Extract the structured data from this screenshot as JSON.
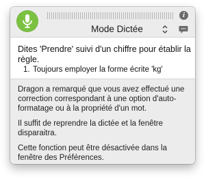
{
  "toolbar": {
    "mic_icon": "microphone-icon",
    "info_icon": "info-icon",
    "info_glyph": "i",
    "mode_label": "Mode Dictée",
    "mode_chevron_icon": "chevron-up-down-icon",
    "chat_icon": "speech-bubble-icon",
    "mic_color": "#7cc242"
  },
  "prompt": {
    "instruction": "Dites 'Prendre' suivi d'un chiffre pour établir la règle.",
    "steps": [
      {
        "number": "1.",
        "text": "Toujours employer la forme écrite 'kg'"
      }
    ]
  },
  "description": {
    "paragraphs": [
      "Dragon a remarqué que vous avez effectué une correction correspondant à une option d'auto-formatage ou à la propriété d'un mot.",
      "Il suffit de reprendre la dictée et la fenêtre disparaitra.",
      "Cette fonction peut être désactivée dans la fenêtre des Préférences."
    ]
  }
}
